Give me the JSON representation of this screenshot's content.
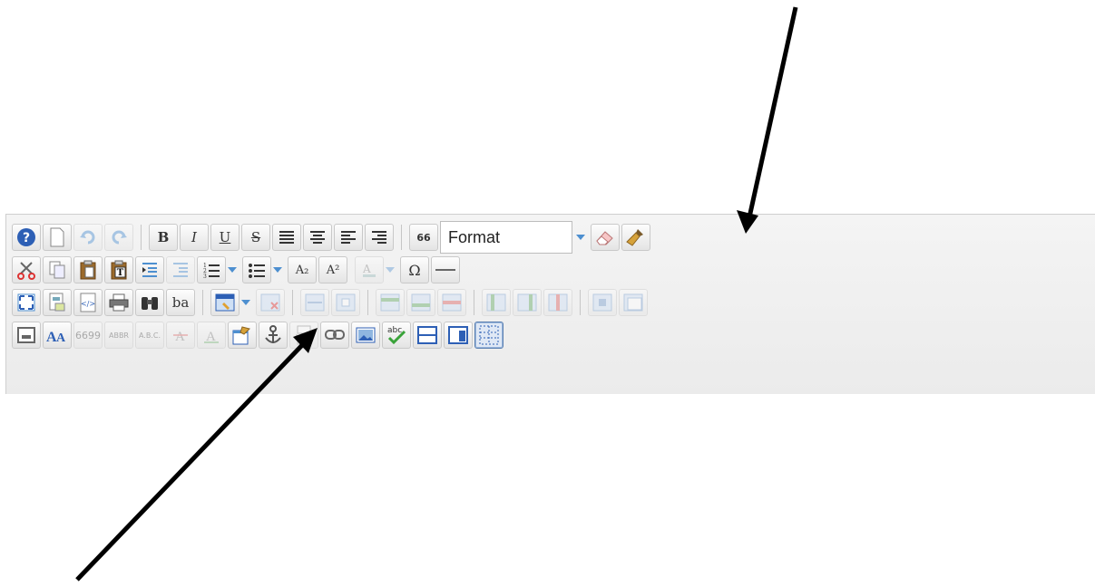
{
  "toolbar": {
    "format_select": {
      "value": "Format",
      "options_visible": [
        "Format"
      ]
    },
    "rows": [
      {
        "row": 1,
        "buttons": [
          "help-icon",
          "new-page-icon",
          "undo-icon",
          "redo-icon",
          "bold-icon",
          "italic-icon",
          "underline-icon",
          "strikethrough-icon",
          "justify-icon",
          "align-center-icon",
          "align-left-icon",
          "align-right-icon",
          "blockquote-icon",
          "format-select",
          "remove-format-icon",
          "cleanup-icon"
        ]
      },
      {
        "row": 2,
        "buttons": [
          "cut-icon",
          "copy-icon",
          "paste-icon",
          "paste-text-icon",
          "indent-icon",
          "outdent-icon",
          "numbered-list-icon",
          "bulleted-list-icon",
          "subscript-icon",
          "superscript-icon",
          "text-color-icon",
          "special-char-icon",
          "horizontal-rule-icon"
        ]
      },
      {
        "row": 3,
        "buttons": [
          "fullscreen-icon",
          "templates-icon",
          "source-icon",
          "print-icon",
          "find-icon",
          "replace-icon",
          "table-icon",
          "delete-table-icon",
          "merge-cells-icon",
          "split-cell-icon",
          "row-before-icon",
          "row-after-icon",
          "delete-row-icon",
          "col-before-icon",
          "col-after-icon",
          "delete-col-icon",
          "cell-props-icon",
          "table-props-icon"
        ]
      },
      {
        "row": 4,
        "buttons": [
          "iframe-icon",
          "styles-icon",
          "cite-icon",
          "abbr-icon",
          "acronym-icon",
          "del-icon",
          "ins-icon",
          "edit-icon",
          "anchor-icon",
          "pagebreak-icon",
          "link-icon",
          "image-icon",
          "spellcheck-icon",
          "layer-icon",
          "div-icon",
          "show-blocks-icon"
        ]
      }
    ],
    "labels": {
      "bold": "B",
      "italic": "I",
      "underline": "U",
      "strike": "S",
      "quote": "66",
      "subscript": "A₂",
      "superscript": "A²",
      "omega": "Ω",
      "replace": "ba",
      "cite": "6699",
      "abbr": "ABBR",
      "acronym": "A.B.C.",
      "spell": "abc"
    }
  },
  "colors": {
    "accent": "#4d8fd0",
    "annotation_arrow": "#000000"
  }
}
